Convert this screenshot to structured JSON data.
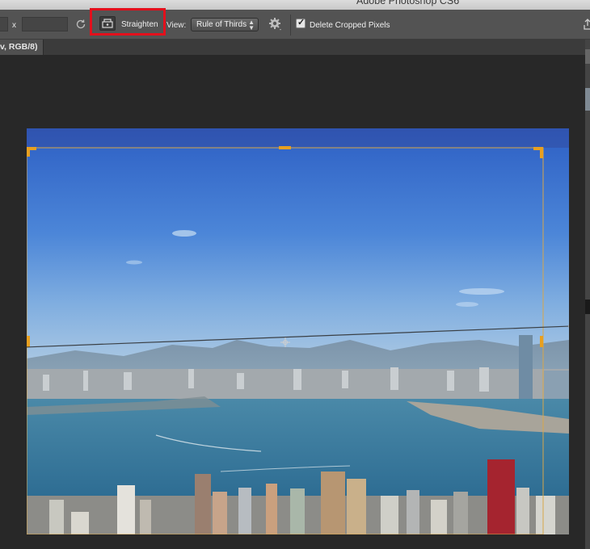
{
  "window": {
    "title": "Adobe Photoshop CS6"
  },
  "options_bar": {
    "ratio_separator": "x",
    "straighten_label": "Straighten",
    "view_label": "View:",
    "view_value": "Rule of Thirds",
    "delete_cropped_label": "Delete Cropped Pixels",
    "delete_cropped_checked": true
  },
  "document_tab": {
    "label": "v, RGB/8)"
  },
  "colors": {
    "highlight": "#e3101c",
    "crop_handle": "#e8a020",
    "panel": "#535353",
    "canvas": "#282828"
  },
  "icons": {
    "rotate": "rotate-icon",
    "straighten": "level-icon",
    "settings": "gear-icon",
    "check": "checkmark-icon",
    "share": "share-icon"
  }
}
